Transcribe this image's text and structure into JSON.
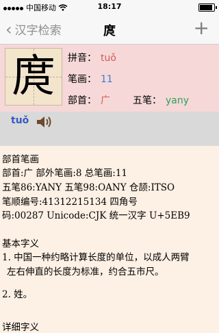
{
  "status": {
    "carrier": "中国移动",
    "wifi_icon": "wifi-icon",
    "time": "18:17"
  },
  "nav": {
    "back_label": "汉字检索",
    "title": "庹",
    "add_icon": "plus-icon"
  },
  "info": {
    "character": "庹",
    "pinyin_label": "拼音：",
    "pinyin": "tuǒ",
    "strokes_label": "笔画：",
    "strokes": "11",
    "radical_label": "部首：",
    "radical": "广",
    "wubi_label": "五笔：",
    "wubi": "yany"
  },
  "pronunciation": {
    "pinyin": "tuǒ",
    "icon": "speaker-icon"
  },
  "content": {
    "lines": [
      "部首笔画",
      "部首:广  部外笔画:8  总笔画:11",
      "五笔86:YANY  五笔98:OANY  仓颉:ITSO",
      "笔顺编号:41312215134   四角号",
      "码:00287  Unicode:CJK 统一汉字 U+5EB9",
      "基本字义",
      "1. 中国一种约略计算长度的单位，以成人两臂",
      "左右伸直的长度为标准，约合五市尺。",
      "2. 姓。",
      "详细字义"
    ]
  },
  "colors": {
    "info_bg": "#f6d8d8",
    "pron_bg": "#d9d9d9",
    "content_bg": "#fdf0e4",
    "pinyin": "#d25a5a",
    "stroke": "#3b7bd5",
    "wubi": "#27a35b"
  }
}
